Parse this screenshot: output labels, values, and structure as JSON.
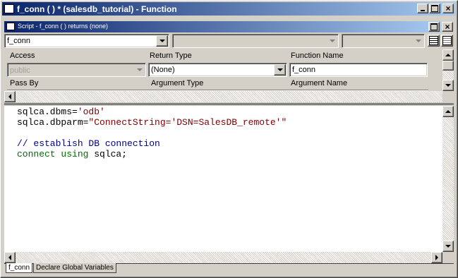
{
  "window": {
    "title": "f_conn ( ) * (salesdb_tutorial) - Function"
  },
  "script_panel": {
    "title": "Script - f_conn ( ) returns (none)",
    "object_combo": "f_conn",
    "event_combo": "",
    "ancestor_combo": ""
  },
  "properties": {
    "access_label": "Access",
    "access_value": "public",
    "return_type_label": "Return Type",
    "return_type_value": "(None)",
    "function_name_label": "Function Name",
    "function_name_value": "f_conn",
    "pass_by_label": "Pass By",
    "argument_type_label": "Argument Type",
    "argument_name_label": "Argument Name"
  },
  "code": {
    "line1": {
      "a": "sqlca.dbms=",
      "b": "'odb'"
    },
    "line2": {
      "a": "sqlca.dbparm=",
      "b": "\"ConnectString='DSN=SalesDB_remote'\""
    },
    "line3": {
      "comment": "// establish DB connection"
    },
    "line4": {
      "kw": "connect using",
      "rest": " sqlca;"
    }
  },
  "tabs": [
    "f_conn",
    "Declare Global Variables"
  ],
  "icons": [
    "script-icon",
    "minimize-icon",
    "maximize-icon",
    "close-icon",
    "list-view-icon",
    "grid-view-icon"
  ]
}
